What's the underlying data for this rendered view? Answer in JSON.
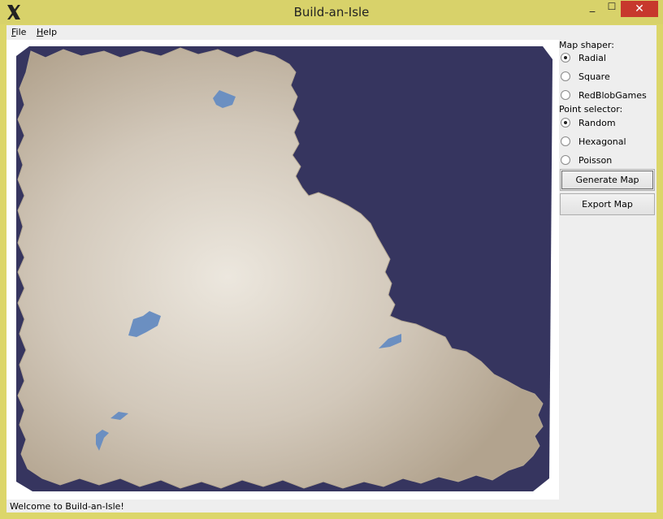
{
  "window": {
    "title": "Build-an-Isle",
    "minimize_glyph": "_",
    "maximize_glyph": "☐",
    "close_glyph": "✕"
  },
  "menu": {
    "file": {
      "mnemonic": "F",
      "rest": "ile"
    },
    "help": {
      "mnemonic": "H",
      "rest": "elp"
    }
  },
  "controls": {
    "map_shaper_label": "Map shaper:",
    "map_shapers": [
      {
        "label": "Radial",
        "selected": true
      },
      {
        "label": "Square",
        "selected": false
      },
      {
        "label": "RedBlobGames",
        "selected": false
      }
    ],
    "point_selector_label": "Point selector:",
    "point_selectors": [
      {
        "label": "Random",
        "selected": true
      },
      {
        "label": "Hexagonal",
        "selected": false
      },
      {
        "label": "Poisson",
        "selected": false
      }
    ],
    "generate_button": "Generate Map",
    "export_button": "Export Map"
  },
  "status": {
    "message": "Welcome to Build-an-Isle!"
  },
  "colors": {
    "ocean": "#36355f",
    "land_light": "#ece7de",
    "land_dark": "#b2a38e",
    "lake": "#6b8fc1",
    "close": "#c7382d"
  }
}
